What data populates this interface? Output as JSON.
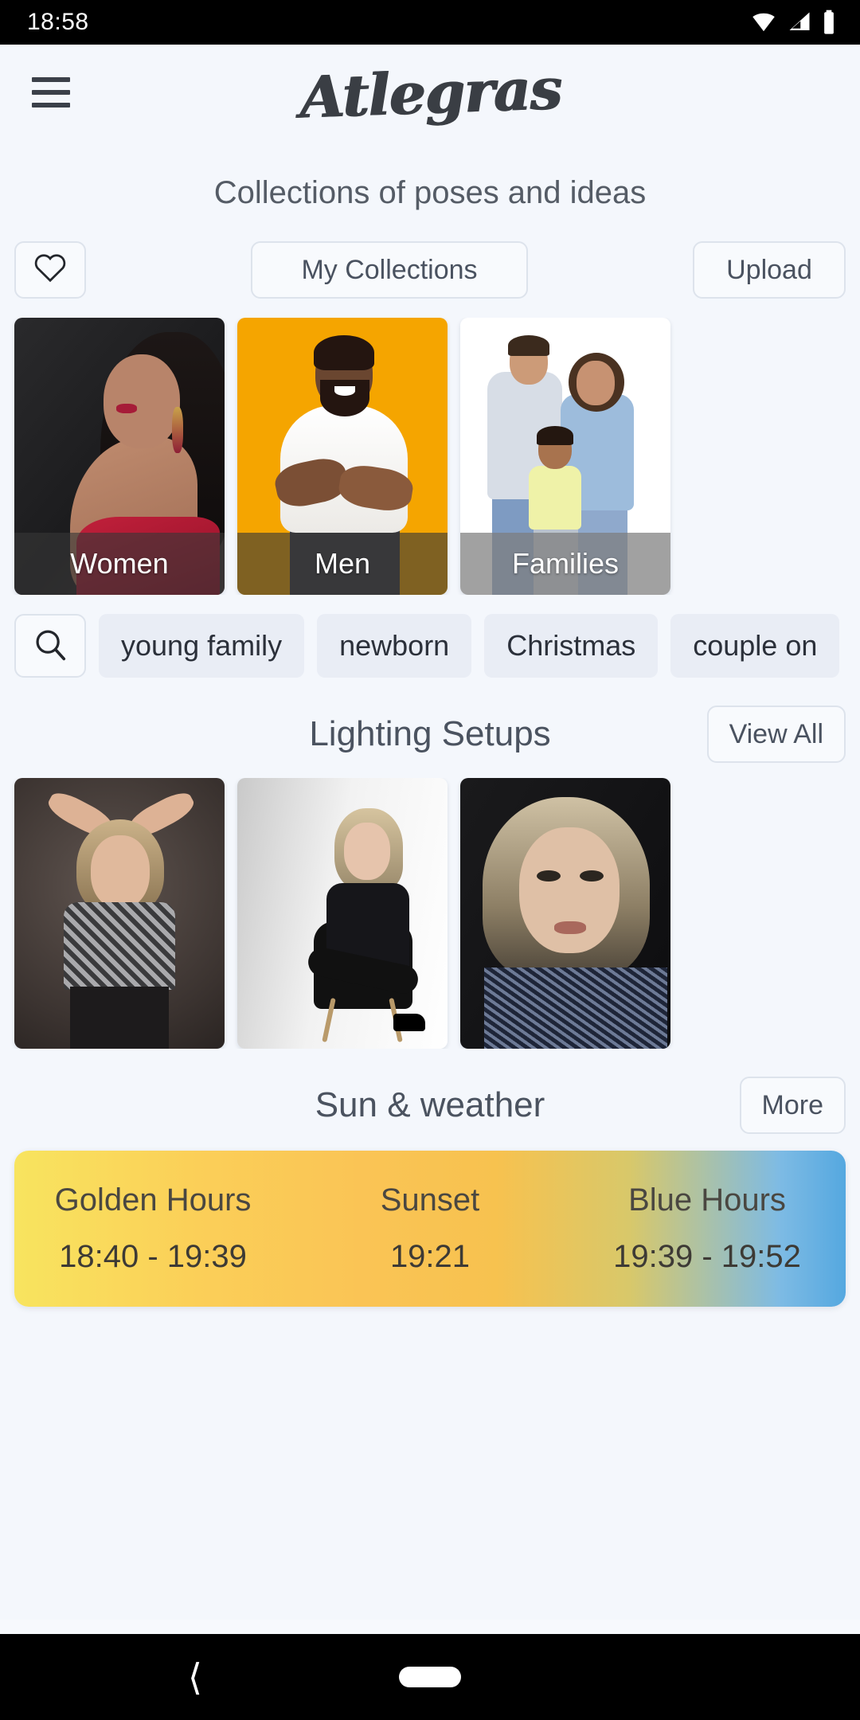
{
  "status_bar": {
    "time": "18:58",
    "icons": [
      "wifi-icon",
      "cellular-signal-icon",
      "battery-icon"
    ]
  },
  "header": {
    "menu_icon": "hamburger-menu-icon",
    "logo_text": "Atlegras"
  },
  "subtitle": "Collections of poses and ideas",
  "action_buttons": {
    "favorites_icon": "heart-outline-icon",
    "collections_label": "My Collections",
    "upload_label": "Upload"
  },
  "categories": [
    {
      "label": "Women"
    },
    {
      "label": "Men"
    },
    {
      "label": "Families"
    }
  ],
  "tags": {
    "search_icon": "search-icon",
    "items": [
      "young family",
      "newborn",
      "Christmas",
      "couple on"
    ]
  },
  "lighting_section": {
    "title": "Lighting Setups",
    "action_label": "View All"
  },
  "sun_section": {
    "title": "Sun & weather",
    "action_label": "More",
    "columns": [
      {
        "label": "Golden Hours",
        "value": "18:40 - 19:39"
      },
      {
        "label": "Sunset",
        "value": "19:21"
      },
      {
        "label": "Blue Hours",
        "value": "19:39 - 19:52"
      }
    ]
  },
  "nav_bar": {
    "back_icon": "back-chevron-icon",
    "home_icon": "home-pill-icon"
  },
  "colors": {
    "background": "#f4f7fc",
    "chip_background": "#e9edf5",
    "accent_yellow": "#f8e45f",
    "accent_blue": "#55a8e0",
    "men_card_background": "#f5a500"
  }
}
